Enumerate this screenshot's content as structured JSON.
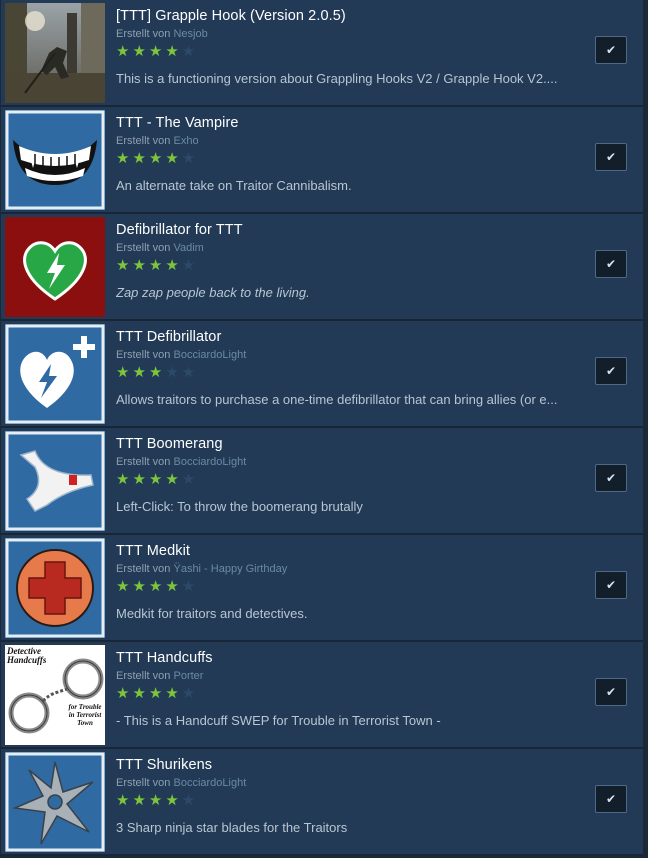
{
  "author_prefix": "Erstellt von",
  "items": [
    {
      "title": "[TTT] Grapple Hook (Version 2.0.5)",
      "author": "Nesjob",
      "rating": 4,
      "description": "This is a functioning version about Grappling Hooks V2 / Grapple Hook V2....",
      "italic": false,
      "checked": true,
      "icon": "grapple-hook-screenshot"
    },
    {
      "title": "TTT - The Vampire",
      "author": "Exho",
      "rating": 4,
      "description": "An alternate take on Traitor Cannibalism.",
      "italic": false,
      "checked": true,
      "icon": "vampire-teeth-icon"
    },
    {
      "title": "Defibrillator for TTT",
      "author": "Vadim",
      "rating": 4,
      "description": "Zap zap people back to the living.",
      "italic": true,
      "checked": true,
      "icon": "defibrillator-heart-icon"
    },
    {
      "title": "TTT Defibrillator",
      "author": "BocciardoLight",
      "rating": 3,
      "description": "Allows traitors to purchase a one-time defibrillator that can bring allies (or e...",
      "italic": false,
      "checked": true,
      "icon": "heart-plus-icon"
    },
    {
      "title": "TTT Boomerang",
      "author": "BocciardoLight",
      "rating": 4,
      "description": "Left-Click: To throw the boomerang brutally",
      "italic": false,
      "checked": true,
      "icon": "boomerang-icon"
    },
    {
      "title": "TTT Medkit",
      "author": "Ÿashi - Happy Girthday",
      "rating": 4,
      "description": "Medkit for traitors and detectives.",
      "italic": false,
      "checked": true,
      "icon": "medkit-cross-icon"
    },
    {
      "title": "TTT Handcuffs",
      "author": "Porter",
      "rating": 4,
      "description": "- This is a Handcuff SWEP for Trouble in Terrorist Town -",
      "italic": false,
      "checked": true,
      "icon": "handcuffs-icon",
      "thumb_text": {
        "top": "Detective Handcuffs",
        "bottom": "for Trouble in Terrorist Town"
      }
    },
    {
      "title": "TTT Shurikens",
      "author": "BocciardoLight",
      "rating": 4,
      "description": "3 Sharp ninja star blades for the Traitors",
      "italic": false,
      "checked": true,
      "icon": "shuriken-icon"
    }
  ],
  "check_glyph": "✔"
}
